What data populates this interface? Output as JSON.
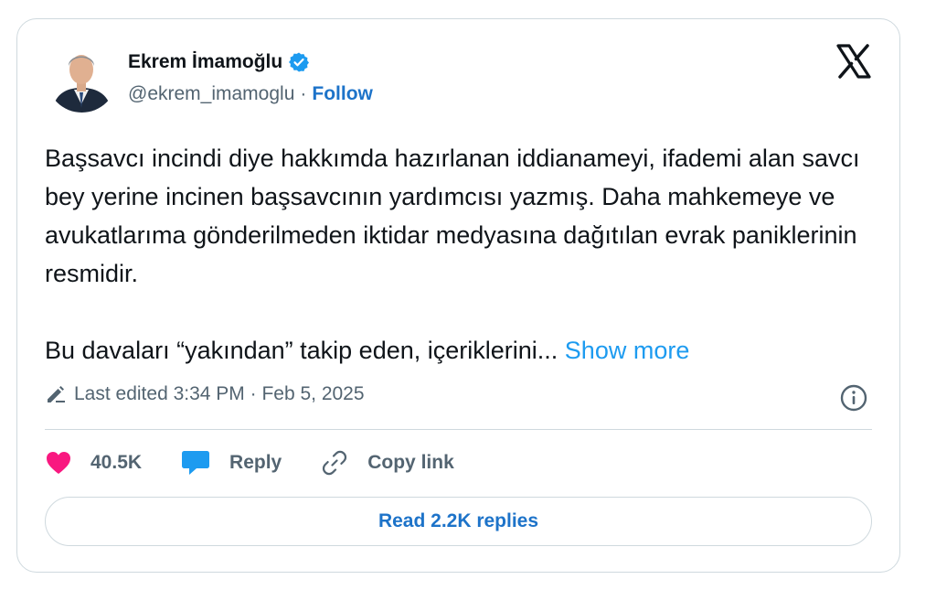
{
  "author": {
    "name": "Ekrem İmamoğlu",
    "handle": "@ekrem_imamoglu",
    "separator": "·",
    "follow_label": "Follow"
  },
  "post": {
    "paragraph1": "Başsavcı incindi diye hakkımda hazırlanan iddianameyi, ifademi alan savcı bey yerine incinen başsavcının yardımcısı yazmış. Daha mahkemeye ve avukatlarıma gönderilmeden iktidar medyasına dağıtılan evrak paniklerinin resmidir.",
    "paragraph2": "Bu davaları “yakından” takip eden, içeriklerini...",
    "show_more": "Show more",
    "edited_label": "Last edited 3:34 PM · Feb 5, 2025"
  },
  "actions": {
    "likes": "40.5K",
    "reply_label": "Reply",
    "copy_link_label": "Copy link",
    "read_replies_label": "Read 2.2K replies"
  },
  "icons": {
    "verified": "verified-badge-icon",
    "x_logo": "x-logo-icon",
    "pencil": "pencil-icon",
    "info": "info-icon",
    "heart": "heart-icon",
    "reply": "reply-bubble-icon",
    "link": "link-icon"
  },
  "colors": {
    "link_blue": "#1d73c9",
    "show_more_blue": "#1d9bf0",
    "heart_pink": "#f91880",
    "muted_text": "#536471",
    "border": "#cfd9de"
  }
}
